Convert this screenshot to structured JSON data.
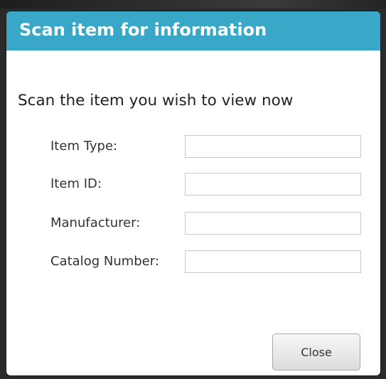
{
  "dialog": {
    "title": "Scan item for information",
    "instruction": "Scan the item you wish to view now",
    "header_color": "#38a7c8",
    "fields": [
      {
        "label": "Item Type:",
        "value": ""
      },
      {
        "label": "Item ID:",
        "value": ""
      },
      {
        "label": "Manufacturer:",
        "value": ""
      },
      {
        "label": "Catalog Number:",
        "value": ""
      }
    ],
    "close_label": "Close"
  }
}
